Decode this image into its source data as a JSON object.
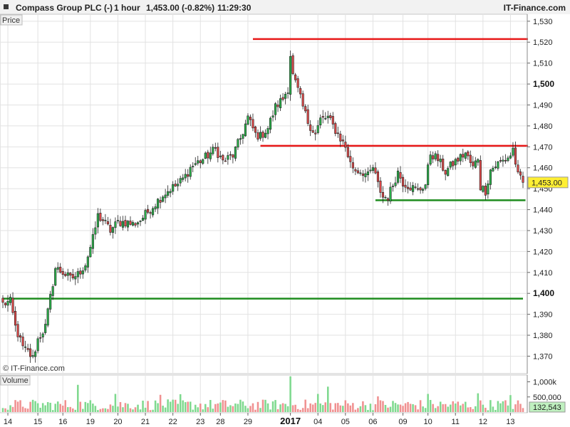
{
  "header": {
    "title": "Compass Group PLC (-)",
    "interval": "1 hour",
    "quote": "1,453.00 (-0.82%)",
    "time": "11:29:30",
    "brand": "IT-Finance.com"
  },
  "price_panel": {
    "label": "Price",
    "credit": "© IT-Finance.com"
  },
  "volume_panel": {
    "label": "Volume"
  },
  "colors": {
    "up": "#2ab24a",
    "down": "#e04848",
    "resistance": "#e81818",
    "support": "#1e8c1e",
    "last_price_badge": "#ffef33",
    "volume_badge": "#bff0bf",
    "grid": "#e2e2e2"
  },
  "chart_data": [
    {
      "type": "candlestick",
      "ylim": [
        1362,
        1533
      ],
      "y_ticks": [
        {
          "value": 1370,
          "label": "1,370"
        },
        {
          "value": 1380,
          "label": "1,380"
        },
        {
          "value": 1390,
          "label": "1,390"
        },
        {
          "value": 1400,
          "label": "1,400",
          "bold": true
        },
        {
          "value": 1410,
          "label": "1,410"
        },
        {
          "value": 1420,
          "label": "1,420"
        },
        {
          "value": 1430,
          "label": "1,430"
        },
        {
          "value": 1440,
          "label": "1,440"
        },
        {
          "value": 1450,
          "label": "1,450"
        },
        {
          "value": 1460,
          "label": "1,460"
        },
        {
          "value": 1470,
          "label": "1,470"
        },
        {
          "value": 1480,
          "label": "1,480"
        },
        {
          "value": 1490,
          "label": "1,490"
        },
        {
          "value": 1500,
          "label": "1,500",
          "bold": true
        },
        {
          "value": 1510,
          "label": "1,510"
        },
        {
          "value": 1520,
          "label": "1,520"
        },
        {
          "value": 1530,
          "label": "1,530"
        }
      ],
      "x_ticks": [
        {
          "index": 2,
          "label": "14"
        },
        {
          "index": 14,
          "label": "15"
        },
        {
          "index": 24,
          "label": "16"
        },
        {
          "index": 35,
          "label": "19"
        },
        {
          "index": 46,
          "label": "20"
        },
        {
          "index": 57,
          "label": "21"
        },
        {
          "index": 68,
          "label": "22"
        },
        {
          "index": 79,
          "label": "23"
        },
        {
          "index": 87,
          "label": "28"
        },
        {
          "index": 98,
          "label": "29"
        },
        {
          "index": 115,
          "label": "2017",
          "bold": true
        },
        {
          "index": 126,
          "label": "04"
        },
        {
          "index": 137,
          "label": "05"
        },
        {
          "index": 148,
          "label": "06"
        },
        {
          "index": 160,
          "label": "09"
        },
        {
          "index": 170,
          "label": "10"
        },
        {
          "index": 181,
          "label": "11"
        },
        {
          "index": 192,
          "label": "12"
        },
        {
          "index": 203,
          "label": "13"
        }
      ],
      "last_price": {
        "value": 1453,
        "label": "1,453.00"
      },
      "levels": [
        {
          "name": "resistance",
          "value": 1521.5,
          "from": 100,
          "to": 210,
          "color": "resistance"
        },
        {
          "name": "resistance",
          "value": 1470.5,
          "from": 103,
          "to": 210,
          "color": "resistance"
        },
        {
          "name": "support",
          "value": 1444.5,
          "from": 149,
          "to": 209,
          "color": "support"
        },
        {
          "name": "support",
          "value": 1397.5,
          "from": 0,
          "to": 208,
          "color": "support"
        }
      ],
      "bar_count": 209,
      "path": [
        [
          0,
          1395
        ],
        [
          3,
          1396
        ],
        [
          5,
          1384
        ],
        [
          8,
          1374
        ],
        [
          10,
          1372
        ],
        [
          12,
          1369
        ],
        [
          14,
          1378
        ],
        [
          17,
          1384
        ],
        [
          19,
          1398
        ],
        [
          21,
          1412
        ],
        [
          24,
          1410
        ],
        [
          27,
          1407
        ],
        [
          30,
          1409
        ],
        [
          33,
          1414
        ],
        [
          36,
          1426
        ],
        [
          38,
          1437
        ],
        [
          40,
          1435
        ],
        [
          43,
          1430
        ],
        [
          46,
          1434
        ],
        [
          49,
          1434
        ],
        [
          52,
          1433
        ],
        [
          55,
          1435
        ],
        [
          58,
          1439
        ],
        [
          61,
          1443
        ],
        [
          64,
          1447
        ],
        [
          67,
          1450
        ],
        [
          70,
          1452
        ],
        [
          73,
          1456
        ],
        [
          75,
          1460
        ],
        [
          77,
          1462
        ],
        [
          80,
          1464
        ],
        [
          83,
          1467
        ],
        [
          85,
          1469
        ],
        [
          88,
          1463
        ],
        [
          92,
          1466
        ],
        [
          95,
          1474
        ],
        [
          98,
          1484
        ],
        [
          101,
          1476
        ],
        [
          103,
          1475
        ],
        [
          106,
          1479
        ],
        [
          109,
          1489
        ],
        [
          112,
          1493
        ],
        [
          114,
          1498
        ],
        [
          115,
          1514
        ],
        [
          116,
          1504
        ],
        [
          118,
          1497
        ],
        [
          120,
          1489
        ],
        [
          122,
          1482
        ],
        [
          125,
          1476
        ],
        [
          127,
          1483
        ],
        [
          130,
          1484
        ],
        [
          133,
          1478
        ],
        [
          135,
          1474
        ],
        [
          137,
          1470
        ],
        [
          139,
          1462
        ],
        [
          141,
          1459
        ],
        [
          144,
          1458
        ],
        [
          146,
          1456
        ],
        [
          148,
          1460
        ],
        [
          150,
          1452
        ],
        [
          152,
          1446
        ],
        [
          154,
          1446
        ],
        [
          156,
          1452
        ],
        [
          158,
          1458
        ],
        [
          160,
          1453
        ],
        [
          163,
          1451
        ],
        [
          166,
          1449
        ],
        [
          169,
          1452
        ],
        [
          171,
          1467
        ],
        [
          174,
          1464
        ],
        [
          177,
          1458
        ],
        [
          180,
          1462
        ],
        [
          183,
          1465
        ],
        [
          185,
          1467
        ],
        [
          188,
          1460
        ],
        [
          190,
          1465
        ],
        [
          191,
          1451
        ],
        [
          193,
          1449
        ],
        [
          195,
          1459
        ],
        [
          198,
          1462
        ],
        [
          201,
          1464
        ],
        [
          203,
          1466
        ],
        [
          204,
          1469
        ],
        [
          206,
          1456
        ],
        [
          208,
          1453
        ]
      ]
    },
    {
      "type": "bar",
      "series_name": "Volume",
      "ylim": [
        0,
        1200000
      ],
      "y_ticks": [
        {
          "value": 1000000,
          "label": "1,000k"
        },
        {
          "value": 500000,
          "label": "500,000"
        }
      ],
      "last_volume": {
        "value": 132543,
        "label": "132,543"
      },
      "spikes": [
        [
          30,
          900000
        ],
        [
          45,
          600000
        ],
        [
          63,
          570000
        ],
        [
          71,
          590000
        ],
        [
          115,
          1180000
        ],
        [
          126,
          600000
        ],
        [
          130,
          840000
        ],
        [
          150,
          520000
        ],
        [
          170,
          600000
        ],
        [
          190,
          620000
        ],
        [
          203,
          560000
        ]
      ]
    }
  ]
}
